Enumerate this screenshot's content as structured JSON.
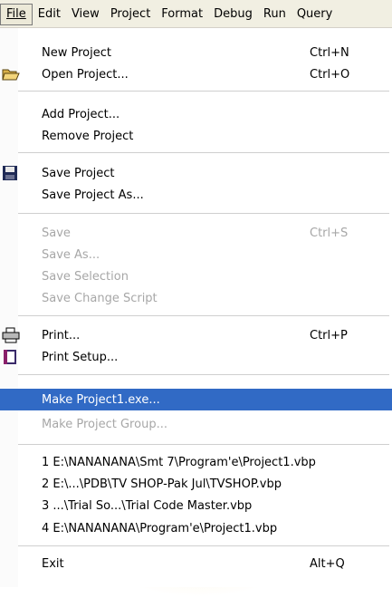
{
  "menubar": {
    "items": [
      "File",
      "Edit",
      "View",
      "Project",
      "Format",
      "Debug",
      "Run",
      "Query"
    ]
  },
  "file_menu": {
    "groups": [
      {
        "label": "New Project",
        "shortcut": "Ctrl+N",
        "icon": "none",
        "enabled": true
      },
      {
        "label": "Open Project...",
        "shortcut": "Ctrl+O",
        "icon": "open-folder-icon",
        "enabled": true
      },
      {
        "label": "Add Project...",
        "shortcut": "",
        "icon": "none",
        "enabled": true
      },
      {
        "label": "Remove Project",
        "shortcut": "",
        "icon": "none",
        "enabled": true
      },
      {
        "label": "Save Project",
        "shortcut": "",
        "icon": "floppy-disk-icon",
        "enabled": true
      },
      {
        "label": "Save Project As...",
        "shortcut": "",
        "icon": "none",
        "enabled": true
      },
      {
        "label": "Save",
        "shortcut": "Ctrl+S",
        "icon": "none",
        "enabled": false
      },
      {
        "label": "Save As...",
        "shortcut": "",
        "icon": "none",
        "enabled": false
      },
      {
        "label": "Save Selection",
        "shortcut": "",
        "icon": "none",
        "enabled": false
      },
      {
        "label": "Save Change Script",
        "shortcut": "",
        "icon": "none",
        "enabled": false
      },
      {
        "label": "Print...",
        "shortcut": "Ctrl+P",
        "icon": "printer-icon",
        "enabled": true
      },
      {
        "label": "Print Setup...",
        "shortcut": "",
        "icon": "print-setup-icon",
        "enabled": true
      },
      {
        "label": "Make Project1.exe...",
        "shortcut": "",
        "icon": "none",
        "enabled": true,
        "highlighted": true
      },
      {
        "label": "Make Project Group...",
        "shortcut": "",
        "icon": "none",
        "enabled": false
      },
      {
        "label": "1 E:\\NANANANA\\Smt 7\\Program'e\\Project1.vbp",
        "shortcut": "",
        "icon": "none",
        "enabled": true
      },
      {
        "label": "2 E:\\...\\PDB\\TV SHOP-Pak Jul\\TVSHOP.vbp",
        "shortcut": "",
        "icon": "none",
        "enabled": true
      },
      {
        "label": "3 ...\\Trial So...\\Trial Code Master.vbp",
        "shortcut": "",
        "icon": "none",
        "enabled": true
      },
      {
        "label": "4 E:\\NANANANA\\Program'e\\Project1.vbp",
        "shortcut": "",
        "icon": "none",
        "enabled": true
      },
      {
        "label": "Exit",
        "shortcut": "Alt+Q",
        "icon": "none",
        "enabled": true
      }
    ]
  },
  "colors": {
    "highlight": "#316ac5",
    "disabled_text": "#a7a7a7",
    "menubar_bg": "#f1efe2"
  }
}
